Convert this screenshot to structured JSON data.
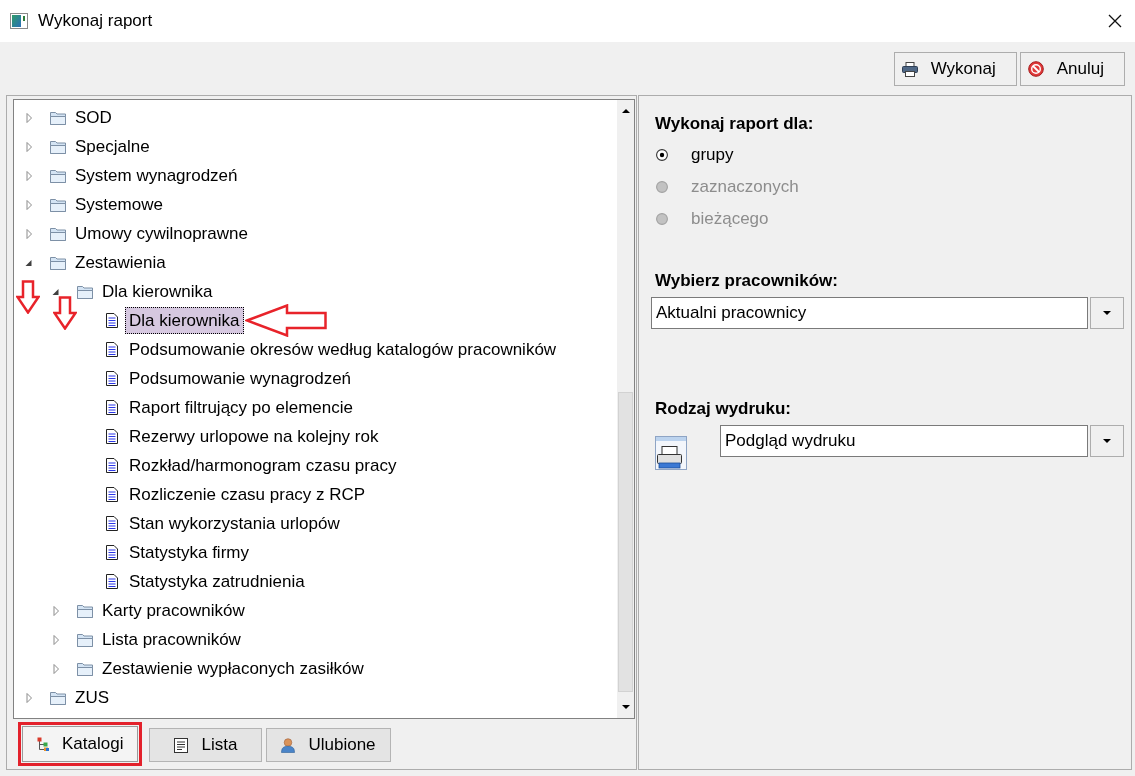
{
  "window": {
    "title": "Wykonaj raport"
  },
  "toolbar": {
    "buttons": [
      {
        "label": "Wykonaj",
        "kind": "print"
      },
      {
        "label": "Anuluj",
        "kind": "cancel"
      }
    ]
  },
  "tree": {
    "items": [
      {
        "label": "SOD",
        "kind": "folder",
        "expanded": false,
        "selected": false,
        "annotated": false
      },
      {
        "label": "Specjalne",
        "kind": "folder",
        "expanded": false,
        "selected": false,
        "annotated": false
      },
      {
        "label": "System wynagrodzeń",
        "kind": "folder",
        "expanded": false,
        "selected": false,
        "annotated": false
      },
      {
        "label": "Systemowe",
        "kind": "folder",
        "expanded": false,
        "selected": false,
        "annotated": false
      },
      {
        "label": "Umowy cywilnoprawne",
        "kind": "folder",
        "expanded": false,
        "selected": false,
        "annotated": false
      },
      {
        "label": "Zestawienia",
        "kind": "folder",
        "expanded": true,
        "selected": false,
        "annotated": true,
        "children": [
          {
            "label": "Dla kierownika",
            "kind": "folder",
            "expanded": true,
            "selected": false,
            "annotated": true,
            "children": [
              {
                "label": "Dla kierownika",
                "kind": "report",
                "selected": true,
                "annotated": true
              },
              {
                "label": "Podsumowanie okresów według katalogów pracowników",
                "kind": "report",
                "selected": false,
                "annotated": false
              },
              {
                "label": "Podsumowanie wynagrodzeń",
                "kind": "report",
                "selected": false,
                "annotated": false
              },
              {
                "label": "Raport filtrujący po elemencie",
                "kind": "report",
                "selected": false,
                "annotated": false
              },
              {
                "label": "Rezerwy urlopowe na kolejny rok",
                "kind": "report",
                "selected": false,
                "annotated": false
              },
              {
                "label": "Rozkład/harmonogram czasu pracy",
                "kind": "report",
                "selected": false,
                "annotated": false
              },
              {
                "label": "Rozliczenie czasu pracy z RCP",
                "kind": "report",
                "selected": false,
                "annotated": false
              },
              {
                "label": "Stan wykorzystania urlopów",
                "kind": "report",
                "selected": false,
                "annotated": false
              },
              {
                "label": "Statystyka firmy",
                "kind": "report",
                "selected": false,
                "annotated": false
              },
              {
                "label": "Statystyka zatrudnienia",
                "kind": "report",
                "selected": false,
                "annotated": false
              }
            ]
          },
          {
            "label": "Karty pracowników",
            "kind": "folder",
            "expanded": false,
            "selected": false,
            "annotated": false
          },
          {
            "label": "Lista pracowników",
            "kind": "folder",
            "expanded": false,
            "selected": false,
            "annotated": false
          },
          {
            "label": "Zestawienie wypłaconych zasiłków",
            "kind": "folder",
            "expanded": false,
            "selected": false,
            "annotated": false
          }
        ]
      },
      {
        "label": "ZUS",
        "kind": "folder",
        "expanded": false,
        "selected": false,
        "annotated": false
      }
    ]
  },
  "view_tabs": [
    {
      "label": "Katalogi",
      "kind": "tree",
      "selected": true,
      "highlighted": true
    },
    {
      "label": "Lista",
      "kind": "list",
      "selected": false,
      "highlighted": false
    },
    {
      "label": "Ulubione",
      "kind": "user",
      "selected": false,
      "highlighted": false
    }
  ],
  "report_for": {
    "heading": "Wykonaj raport dla:",
    "options": [
      {
        "label": "grupy",
        "selected": true,
        "disabled": false
      },
      {
        "label": "zaznaczonych",
        "selected": false,
        "disabled": true
      },
      {
        "label": "bieżącego",
        "selected": false,
        "disabled": true
      }
    ]
  },
  "employees": {
    "heading": "Wybierz pracowników:",
    "value": "Aktualni pracownicy"
  },
  "print_type": {
    "heading": "Rodzaj wydruku:",
    "value": "Podgląd wydruku"
  }
}
